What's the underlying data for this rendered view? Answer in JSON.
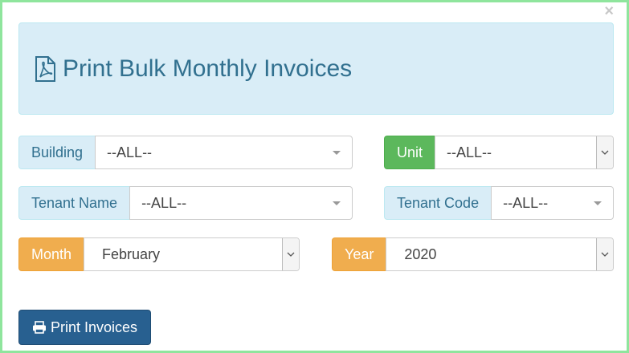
{
  "modal": {
    "close_label": "×",
    "title": "Print Bulk Monthly Invoices",
    "title_icon": "file-pdf-icon"
  },
  "filters": {
    "building": {
      "label": "Building",
      "value": "--ALL--"
    },
    "unit": {
      "label": "Unit",
      "value": "--ALL--"
    },
    "tenant_name": {
      "label": "Tenant Name",
      "value": "--ALL--"
    },
    "tenant_code": {
      "label": "Tenant Code",
      "value": "--ALL--"
    },
    "month": {
      "label": "Month",
      "value": "February"
    },
    "year": {
      "label": "Year",
      "value": "2020"
    }
  },
  "actions": {
    "print_label": "Print Invoices",
    "print_icon": "printer-icon"
  },
  "colors": {
    "info_bg": "#d9edf7",
    "info_text": "#31708f",
    "success": "#5cb85c",
    "warning": "#f0ad4e",
    "primary": "#286090",
    "frame": "#8fe59d"
  }
}
